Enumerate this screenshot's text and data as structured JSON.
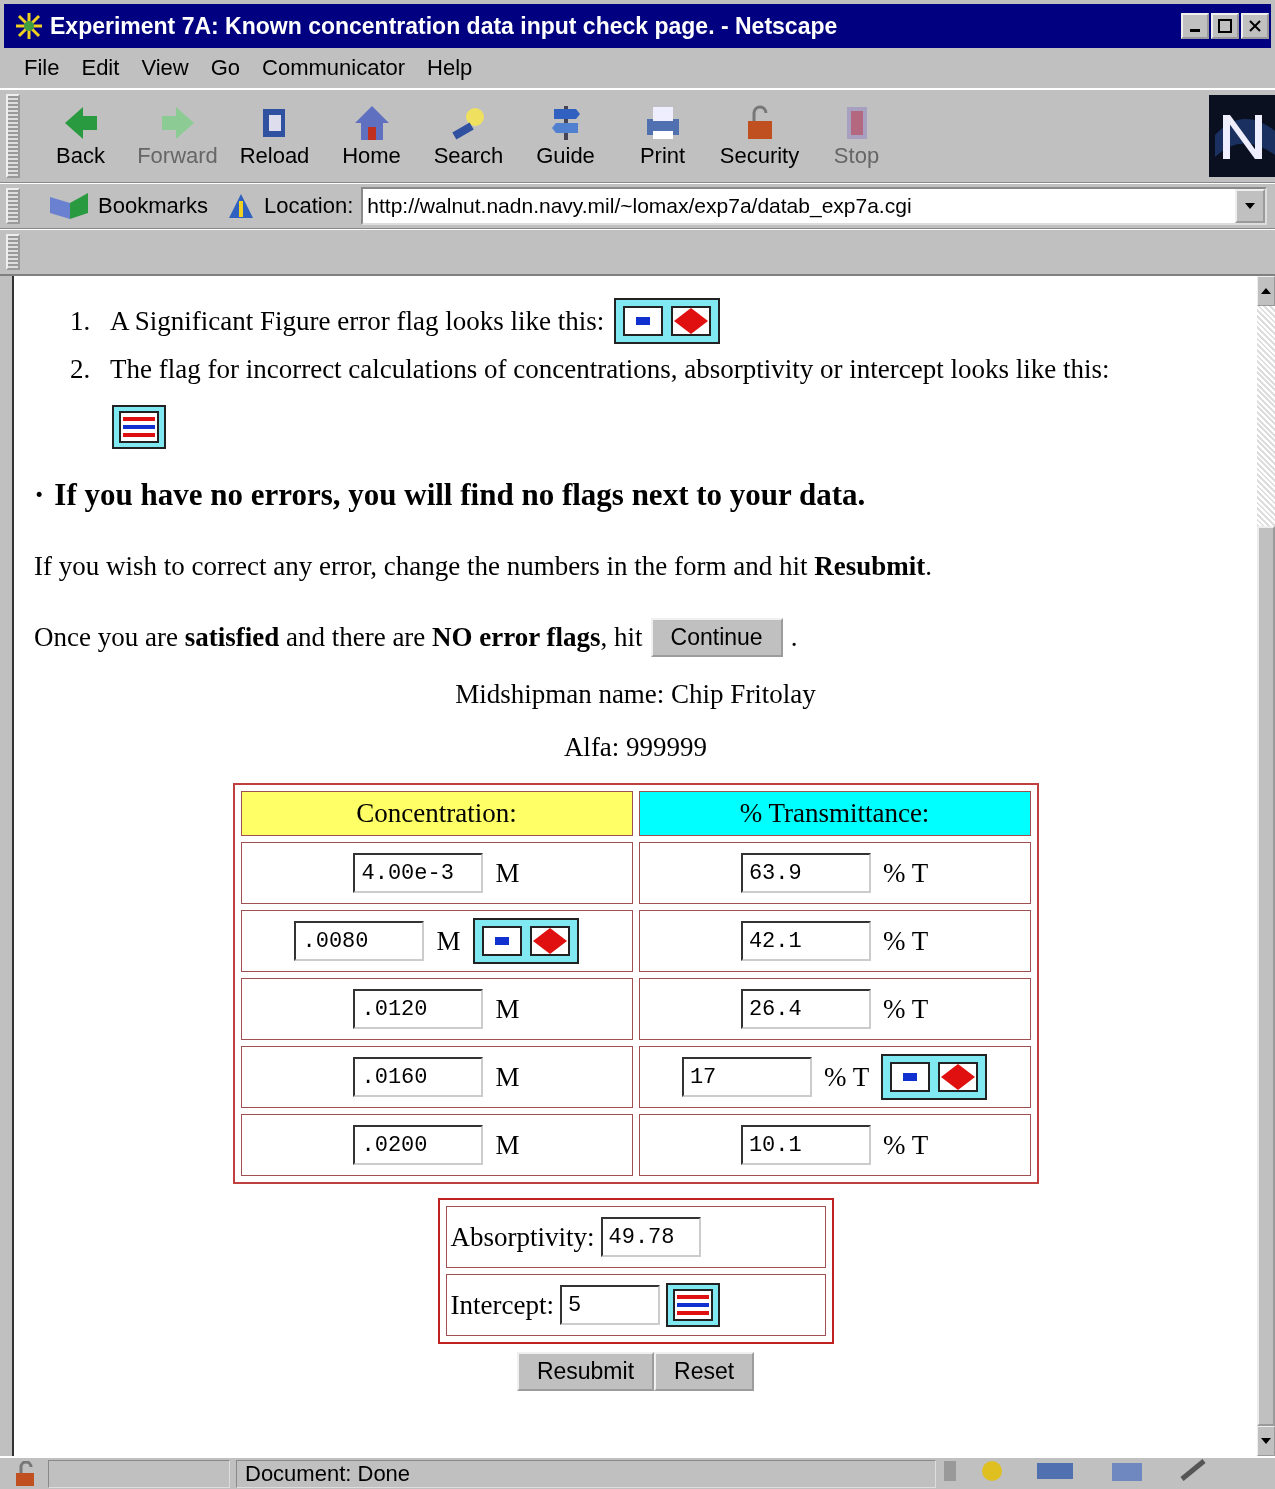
{
  "window": {
    "title": "Experiment 7A: Known concentration data input check page. - Netscape"
  },
  "menu": [
    "File",
    "Edit",
    "View",
    "Go",
    "Communicator",
    "Help"
  ],
  "toolbar": [
    {
      "label": "Back",
      "kind": "back",
      "disabled": false
    },
    {
      "label": "Forward",
      "kind": "forward",
      "disabled": true
    },
    {
      "label": "Reload",
      "kind": "reload",
      "disabled": false
    },
    {
      "label": "Home",
      "kind": "home",
      "disabled": false
    },
    {
      "label": "Search",
      "kind": "search",
      "disabled": false
    },
    {
      "label": "Guide",
      "kind": "guide",
      "disabled": false
    },
    {
      "label": "Print",
      "kind": "print",
      "disabled": false
    },
    {
      "label": "Security",
      "kind": "security",
      "disabled": false
    },
    {
      "label": "Stop",
      "kind": "stop",
      "disabled": true
    }
  ],
  "location_bar": {
    "bookmarks": "Bookmarks",
    "label": "Location:",
    "url": "http://walnut.nadn.navy.mil/~lomax/exp7a/datab_exp7a.cgi"
  },
  "page": {
    "legend": [
      {
        "number": "1.",
        "text": "A Significant Figure error flag looks like this:",
        "flag": {
          "kind": "sigfig"
        }
      },
      {
        "number": "2.",
        "text": "The flag for incorrect calculations of concentrations, absorptivity or intercept looks like this:",
        "flag": {
          "kind": "calc"
        }
      }
    ],
    "bullet": "·",
    "headline": "If you have no errors, you will find no flags next to your data.",
    "correct_text": "If you wish to correct any error, change the numbers in the form and hit **Resubmit**.",
    "continue_text": "Once you are **satisfied** and there are **NO error flags**, hit",
    "continue_button": "Continue",
    "continue_after": ".",
    "name_line": "Midshipman name: Chip Fritolay",
    "alfa_line": "Alfa: 999999",
    "table": {
      "columns": [
        "Concentration:",
        "% Transmittance:"
      ],
      "rows": [
        {
          "concentration": {
            "value": "4.00e-3",
            "unit": "M"
          },
          "transmittance": {
            "value": "63.9",
            "unit": "% T"
          }
        },
        {
          "concentration": {
            "value": ".0080",
            "unit": "M",
            "flag": {
              "kind": "sigfig"
            }
          },
          "transmittance": {
            "value": "42.1",
            "unit": "% T"
          }
        },
        {
          "concentration": {
            "value": ".0120",
            "unit": "M"
          },
          "transmittance": {
            "value": "26.4",
            "unit": "% T"
          }
        },
        {
          "concentration": {
            "value": ".0160",
            "unit": "M"
          },
          "transmittance": {
            "value": "17",
            "unit": "% T",
            "flag": {
              "kind": "sigfig"
            }
          }
        },
        {
          "concentration": {
            "value": ".0200",
            "unit": "M"
          },
          "transmittance": {
            "value": "10.1",
            "unit": "% T"
          }
        }
      ]
    },
    "results": [
      {
        "label": "Absorptivity:",
        "value": "49.78"
      },
      {
        "label": "Intercept:",
        "value": "5",
        "flag": {
          "kind": "calc"
        }
      }
    ],
    "buttons": [
      "Resubmit",
      "Reset"
    ]
  },
  "status_bar": {
    "text": "Document: Done"
  }
}
